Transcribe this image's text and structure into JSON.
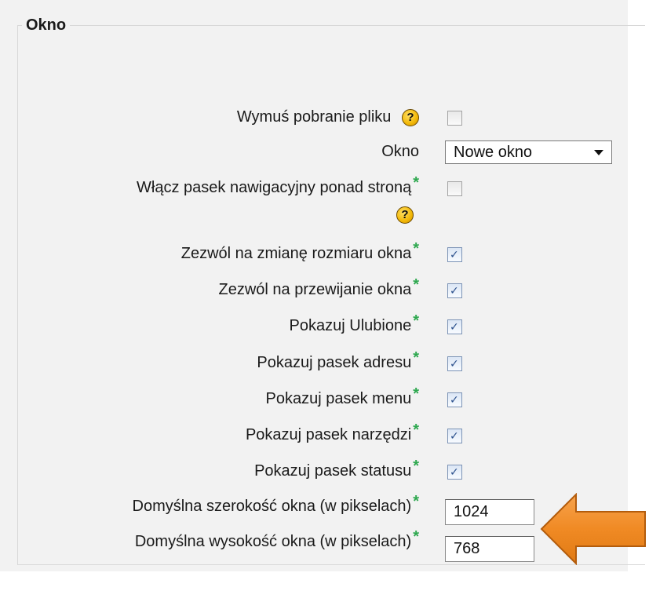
{
  "fieldset": {
    "legend": "Okno"
  },
  "rows": {
    "force_download": {
      "label": "Wymuś pobranie pliku",
      "help_icon": "help-icon",
      "checked": false
    },
    "window": {
      "label": "Okno",
      "value": "Nowe okno"
    },
    "nav_bar": {
      "label": "Włącz pasek nawigacyjny ponad stroną",
      "required_mark": "*",
      "help_icon": "help-icon",
      "checked": false
    },
    "resize": {
      "label": "Zezwól na zmianę rozmiaru okna",
      "required_mark": "*",
      "checked": true
    },
    "scroll": {
      "label": "Zezwól na przewijanie okna",
      "required_mark": "*",
      "checked": true
    },
    "favorites": {
      "label": "Pokazuj Ulubione",
      "required_mark": "*",
      "checked": true
    },
    "address_bar": {
      "label": "Pokazuj pasek adresu",
      "required_mark": "*",
      "checked": true
    },
    "menu_bar": {
      "label": "Pokazuj pasek menu",
      "required_mark": "*",
      "checked": true
    },
    "toolbar": {
      "label": "Pokazuj pasek narzędzi",
      "required_mark": "*",
      "checked": true
    },
    "status_bar": {
      "label": "Pokazuj pasek statusu",
      "required_mark": "*",
      "checked": true
    },
    "width": {
      "label": "Domyślna szerokość okna (w pikselach)",
      "required_mark": "*",
      "value": "1024"
    },
    "height": {
      "label": "Domyślna wysokość okna (w pikselach)",
      "required_mark": "*",
      "value": "768"
    }
  },
  "help_glyph": "?",
  "check_glyph": "✓",
  "colors": {
    "panel_bg": "#f2f2f2",
    "required_star": "#2ea84f",
    "help_icon": "#f2b705",
    "arrow_fill": "#f08a24",
    "arrow_stroke": "#b35c0c"
  },
  "annotation": {
    "icon": "left-arrow-icon"
  }
}
